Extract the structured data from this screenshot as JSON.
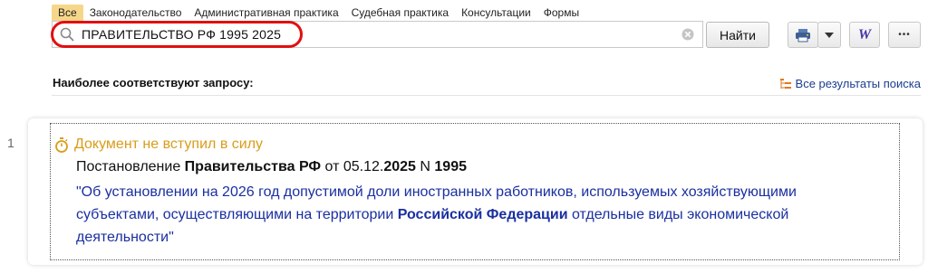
{
  "tabs": [
    "Все",
    "Законодательство",
    "Административная практика",
    "Судебная практика",
    "Консультации",
    "Формы"
  ],
  "search": {
    "value": "ПРАВИТЕЛЬСТВО РФ 1995 2025",
    "button_label": "Найти"
  },
  "toolbar": {
    "word_label": "W",
    "more_label": "•••"
  },
  "results": {
    "heading": "Наиболее соответствуют запросу:",
    "all_results_label": "Все результаты поиска",
    "items": [
      {
        "number": "1",
        "status": "Документ не вступил в силу",
        "doc_type": "Постановление",
        "issuer": "Правительства РФ",
        "date_prefix": "от 05.12.",
        "year": "2025",
        "num_prefix": "N",
        "doc_number": "1995",
        "title_part1": "\"Об установлении на 2026 год допустимой доли иностранных работников, используемых хозяйствующими субъектами, осуществляющими на территории ",
        "title_highlight": "Российской Федерации",
        "title_part2": " отдельные виды экономической деятельности\""
      }
    ]
  },
  "colors": {
    "active_tab": "#f6d78a",
    "highlight_ring": "#e01010",
    "status": "#d99c1a",
    "link": "#1a2fa0"
  },
  "icons": [
    "search-icon",
    "clear-icon",
    "printer-icon",
    "dropdown-arrow-icon",
    "word-icon",
    "more-icon",
    "tree-icon",
    "stopwatch-icon"
  ]
}
